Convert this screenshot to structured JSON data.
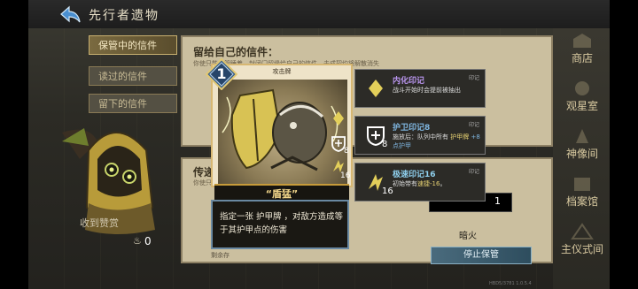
{
  "header": {
    "title": "先行者遗物"
  },
  "left_tabs": [
    {
      "label": "保管中的信件",
      "active": true
    },
    {
      "label": "读过的信件",
      "active": false
    },
    {
      "label": "留下的信件",
      "active": false
    }
  ],
  "left_panel": {
    "received_label": "收到赞赏",
    "received_count": "0"
  },
  "panel_top": {
    "title": "留给自己的信件：",
    "subtitle": "你使只能保管睡着，封闭门留缘给自己的信件，击成契约将解散消失"
  },
  "panel_bottom": {
    "title": "传递给其实",
    "subtitle": "你使只能保管睡着",
    "footer": "剩余存"
  },
  "card": {
    "cost": "1",
    "type": "攻击牌",
    "name": "“盾猛”",
    "description": "指定一张 护甲牌 ，对敌方造成等于其护甲点的伤害",
    "mark_values": [
      "8",
      "16"
    ]
  },
  "sigils": [
    {
      "name": "内化印记",
      "tag": "印记",
      "desc": "战斗开始时会提前被抽出",
      "num": "",
      "name_color": "#b995ee"
    },
    {
      "name": "护卫印记8",
      "tag": "印记",
      "desc_pre": "施放后：队列中所有 ",
      "desc_hl": "护甲牌",
      "desc_post": " +8点护甲",
      "num": "8",
      "name_color": "#7fb6e0"
    },
    {
      "name": "极速印记16",
      "tag": "印记",
      "desc_pre": "初始带有",
      "desc_hl": "速捷-16",
      "desc_post": "。",
      "num": "16",
      "name_color": "#8fd0ee"
    }
  ],
  "ticket_value": "1",
  "dark_fire_label": "暗火",
  "stop_button": "停止保管",
  "right_nav": [
    "商店",
    "观星室",
    "神像间",
    "档案馆",
    "主仪式间"
  ],
  "version": "HBD5/3781 1.0.5.4",
  "colors": {
    "accent_gold": "#d7b772",
    "panel": "#cbbf9f",
    "stop_btn": "#3b5d70"
  }
}
